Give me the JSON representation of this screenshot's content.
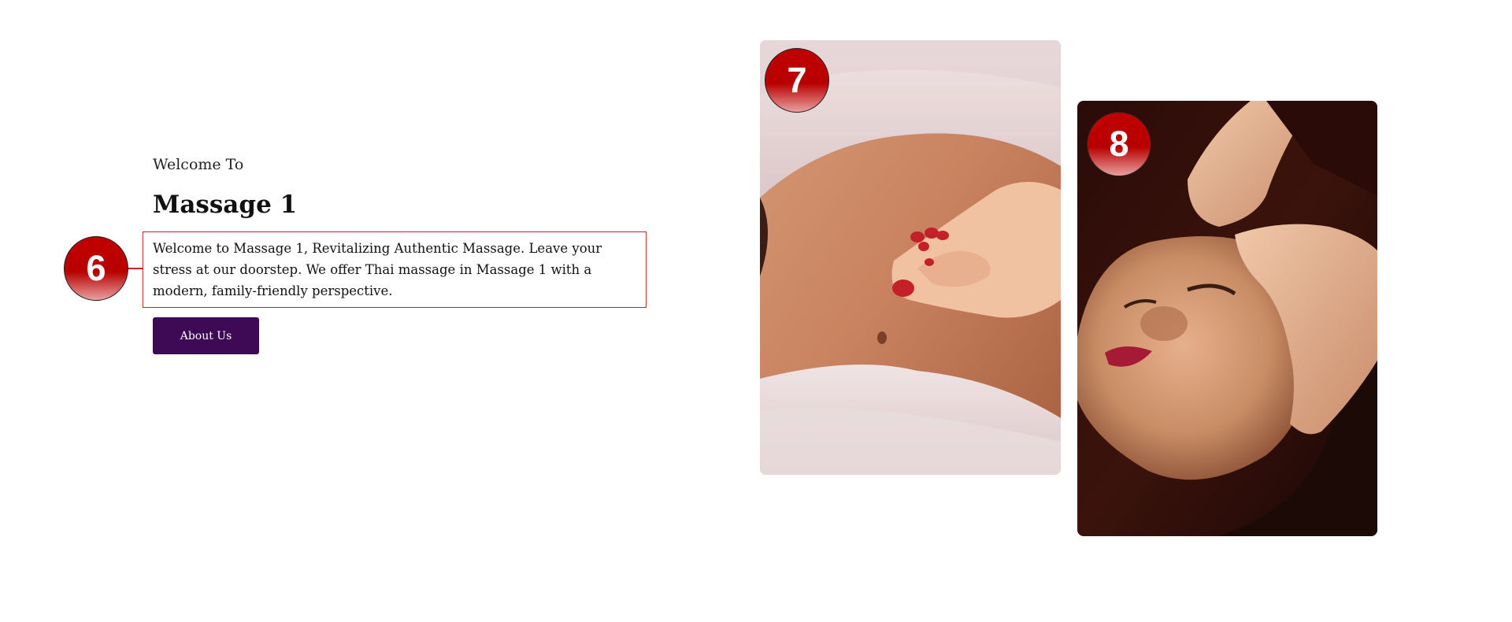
{
  "intro": {
    "eyebrow": "Welcome To",
    "title": "Massage 1",
    "description": "Welcome to Massage 1, Revitalizing Authentic Massage. Leave your stress at our doorstep. We offer Thai massage in Massage 1 with a modern, family-friendly perspective.",
    "button_label": "About Us"
  },
  "annotations": {
    "badge_6": "6",
    "badge_7": "7",
    "badge_8": "8"
  },
  "images": {
    "photo_1": "abdominal-massage-photo",
    "photo_2": "facial-massage-photo"
  },
  "colors": {
    "accent_button": "#3e0a55",
    "annotation_red": "#c8242b"
  }
}
